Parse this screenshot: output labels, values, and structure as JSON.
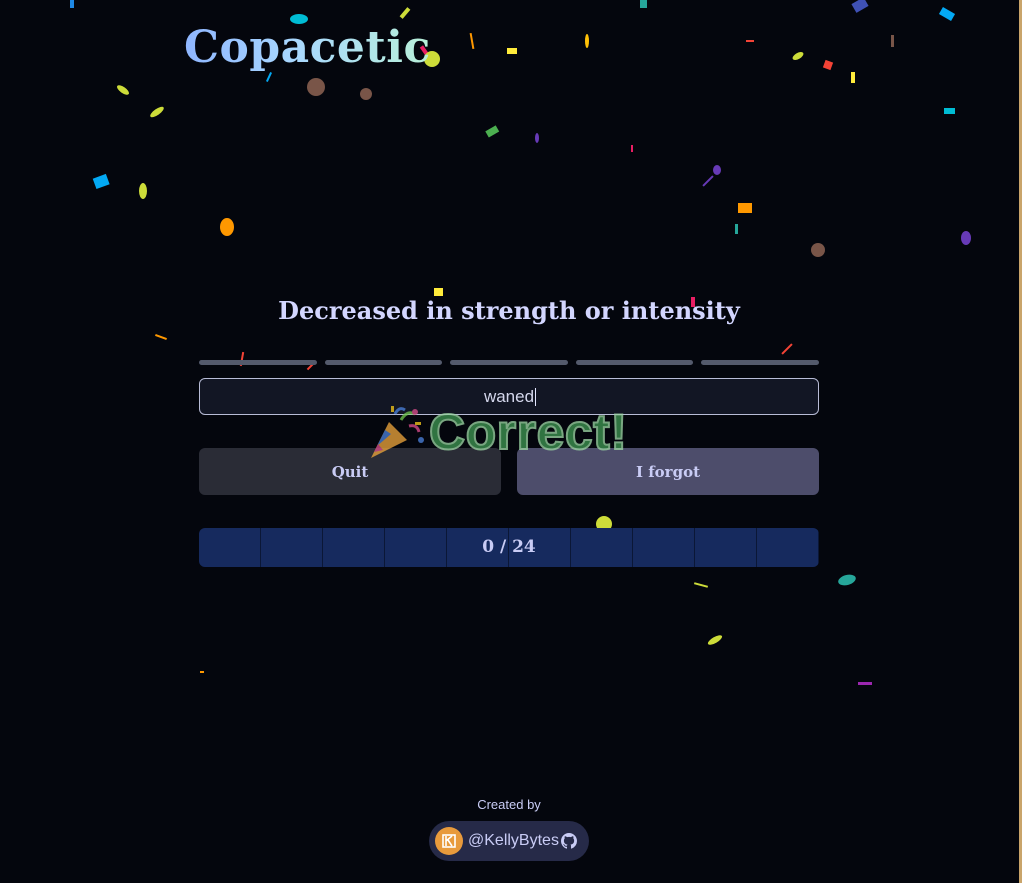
{
  "app": {
    "logo_text": "Copacetic"
  },
  "quiz": {
    "prompt": "Decreased in strength or intensity",
    "hint_segments": 5,
    "answer_value": "waned",
    "quit_label": "Quit",
    "forgot_label": "I forgot",
    "feedback_text": "Correct!",
    "progress_text": "0 / 24",
    "progress_ticks": 10
  },
  "footer": {
    "created_by_label": "Created by",
    "author_handle": "@KellyBytes"
  },
  "colors": {
    "background": "#04060d",
    "accent_text": "#c9ccf5",
    "progress_bar": "#162a5e",
    "correct_green": "#3d9450"
  },
  "icons": {
    "party_popper": "party-popper-icon",
    "github": "github-icon",
    "avatar": "avatar-k-logo"
  }
}
